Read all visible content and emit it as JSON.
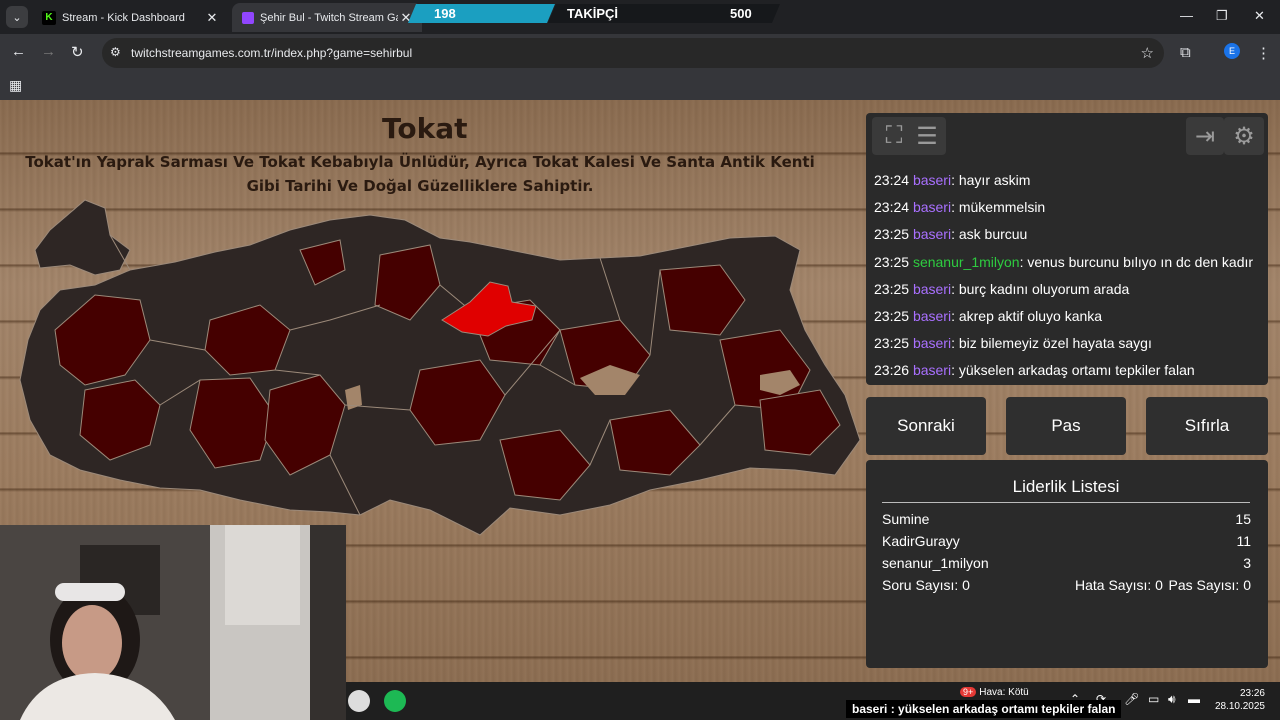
{
  "browser": {
    "tabs": [
      {
        "title": "Stream - Kick Dashboard",
        "favicon": "K",
        "favicon_color": "#53fc18"
      },
      {
        "title": "Şehir Bul - Twitch Stream Game",
        "favicon": "",
        "favicon_color": "#9146ff"
      }
    ],
    "url": "twitchstreamgames.com.tr/index.php?game=sehirbul",
    "profile_initial": "E"
  },
  "follower_overlay": {
    "current": "198",
    "label": "TAKİPÇİ",
    "goal": "500",
    "progress": 0.396
  },
  "game": {
    "city": "Tokat",
    "description": "Tokat'ın Yaprak Sarması Ve Tokat Kebabıyla Ünlüdür, Ayrıca Tokat Kalesi Ve Santa Antik Kenti Gibi Tarihi Ve Doğal Güzelliklere Sahiptir.",
    "highlight_color": "#e00000",
    "found_color": "#450000",
    "default_color": "#2e2624"
  },
  "chat": {
    "messages": [
      {
        "time": "23:24",
        "user": "baseri",
        "text": ": hayır askim",
        "color": "purple"
      },
      {
        "time": "23:24",
        "user": "baseri",
        "text": ": mükemmelsin",
        "color": "purple"
      },
      {
        "time": "23:25",
        "user": "baseri",
        "text": ": ask burcuu",
        "color": "purple"
      },
      {
        "time": "23:25",
        "user": "senanur_1milyon",
        "text": ": venus burcunu bılıyo ın dc den kadır",
        "color": "green"
      },
      {
        "time": "23:25",
        "user": "baseri",
        "text": ": burç kadını oluyorum arada",
        "color": "purple"
      },
      {
        "time": "23:25",
        "user": "baseri",
        "text": ": akrep aktif oluyo kanka",
        "color": "purple"
      },
      {
        "time": "23:25",
        "user": "baseri",
        "text": ": biz bilemeyiz özel hayata saygı",
        "color": "purple"
      },
      {
        "time": "23:26",
        "user": "baseri",
        "text": ": yükselen arkadaş ortamı tepkiler falan",
        "color": "purple"
      }
    ]
  },
  "buttons": {
    "next": "Sonraki",
    "pass": "Pas",
    "reset": "Sıfırla"
  },
  "leaderboard": {
    "title": "Liderlik Listesi",
    "rows": [
      {
        "name": "Sumine",
        "score": "15"
      },
      {
        "name": "KadirGurayy",
        "score": "11"
      },
      {
        "name": "senanur_1milyon",
        "score": "3"
      }
    ],
    "question_count": "Soru Sayısı: 0",
    "error_count": "Hata Sayısı: 0",
    "pass_count": "Pas Sayısı: 0"
  },
  "taskbar": {
    "weather_badge": "9+",
    "weather": "Hava: Kötü",
    "time": "23:26",
    "date": "28.10.2025"
  },
  "ticker": {
    "user": "baseri",
    "text": " : yükselen arkadaş ortamı tepkiler falan"
  }
}
